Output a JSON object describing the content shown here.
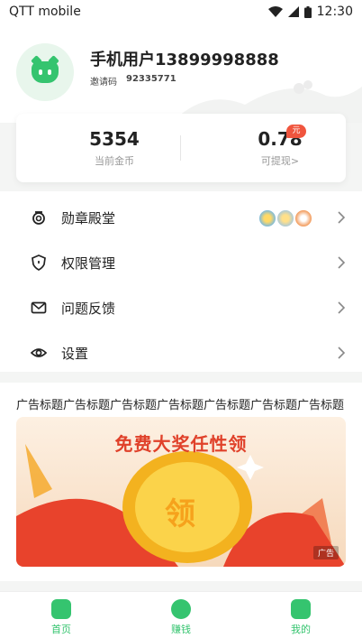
{
  "status_bar": {
    "carrier": "QTT mobile",
    "time": "12:30"
  },
  "profile": {
    "name": "手机用户13899998888",
    "invite_label": "邀请码",
    "invite_code": "92335771"
  },
  "stats": {
    "coins": {
      "value": "5354",
      "label": "当前金币"
    },
    "cash": {
      "value": "0.78",
      "label": "可提现>",
      "badge": "元"
    }
  },
  "menu": {
    "items": [
      {
        "label": "勋章殿堂",
        "icon": "medal-icon"
      },
      {
        "label": "权限管理",
        "icon": "shield-icon"
      },
      {
        "label": "问题反馈",
        "icon": "mail-icon"
      },
      {
        "label": "设置",
        "icon": "eye-settings-icon"
      }
    ]
  },
  "ad": {
    "title": "广告标题广告标题广告标题广告标题广告标题广告标题广告标题",
    "headline": "免费大奖任性领",
    "coin_text": "领",
    "tag": "广告"
  },
  "tabbar": {
    "items": [
      {
        "label": "首页"
      },
      {
        "label": "赚钱"
      },
      {
        "label": "我的"
      }
    ]
  },
  "colors": {
    "accent": "#35c46f",
    "badge": "#f0553e",
    "ad_headline": "#e0412a"
  }
}
